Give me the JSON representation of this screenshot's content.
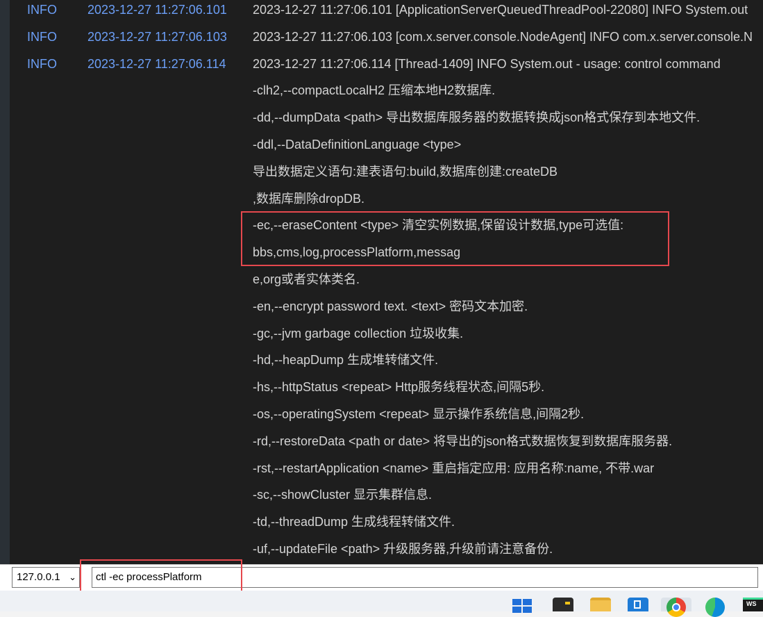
{
  "log_rows": [
    {
      "level": "INFO",
      "time": "2023-12-27 11:27:06.101",
      "message": "2023-12-27 11:27:06.101 [ApplicationServerQueuedThreadPool-22080] INFO System.out"
    },
    {
      "level": "INFO",
      "time": "2023-12-27 11:27:06.103",
      "message": "2023-12-27 11:27:06.103 [com.x.server.console.NodeAgent] INFO com.x.server.console.N"
    },
    {
      "level": "INFO",
      "time": "2023-12-27 11:27:06.114",
      "message": "2023-12-27 11:27:06.114 [Thread-1409] INFO System.out - usage: control command"
    },
    {
      "level": "",
      "time": "",
      "message": "-clh2,--compactLocalH2 压缩本地H2数据库."
    },
    {
      "level": "",
      "time": "",
      "message": "-dd,--dumpData <path> 导出数据库服务器的数据转换成json格式保存到本地文件."
    },
    {
      "level": "",
      "time": "",
      "message": "-ddl,--DataDefinitionLanguage <type>"
    },
    {
      "level": "",
      "time": "",
      "message": "导出数据定义语句:建表语句:build,数据库创建:createDB"
    },
    {
      "level": "",
      "time": "",
      "message": ",数据库删除dropDB."
    },
    {
      "level": "",
      "time": "",
      "message": "-ec,--eraseContent <type> 清空实例数据,保留设计数据,type可选值:"
    },
    {
      "level": "",
      "time": "",
      "message": "bbs,cms,log,processPlatform,messag"
    },
    {
      "level": "",
      "time": "",
      "message": "e,org或者实体类名."
    },
    {
      "level": "",
      "time": "",
      "message": "-en,--encrypt password text. <text> 密码文本加密."
    },
    {
      "level": "",
      "time": "",
      "message": "-gc,--jvm garbage collection 垃圾收集."
    },
    {
      "level": "",
      "time": "",
      "message": "-hd,--heapDump 生成堆转储文件."
    },
    {
      "level": "",
      "time": "",
      "message": "-hs,--httpStatus <repeat> Http服务线程状态,间隔5秒."
    },
    {
      "level": "",
      "time": "",
      "message": "-os,--operatingSystem <repeat> 显示操作系统信息,间隔2秒."
    },
    {
      "level": "",
      "time": "",
      "message": "-rd,--restoreData <path or date> 将导出的json格式数据恢复到数据库服务器."
    },
    {
      "level": "",
      "time": "",
      "message": "-rst,--restartApplication <name> 重启指定应用: 应用名称:name, 不带.war"
    },
    {
      "level": "",
      "time": "",
      "message": "-sc,--showCluster 显示集群信息."
    },
    {
      "level": "",
      "time": "",
      "message": "-td,--threadDump 生成线程转储文件."
    },
    {
      "level": "",
      "time": "",
      "message": "-uf,--updateFile <path> 升级服务器,升级前请注意备份."
    }
  ],
  "command_bar": {
    "host": "127.0.0.1",
    "command": "ctl -ec processPlatform"
  },
  "taskbar": {
    "ws_label": "WS",
    "icons": [
      "windows-start-icon",
      "terminal-icon",
      "file-explorer-icon",
      "app-icon",
      "chrome-icon",
      "edge-icon",
      "webstorm-icon"
    ]
  },
  "colors": {
    "console_bg": "#1e1e1e",
    "timestamp": "#6c9ff7",
    "highlight_border": "#e5484d"
  }
}
